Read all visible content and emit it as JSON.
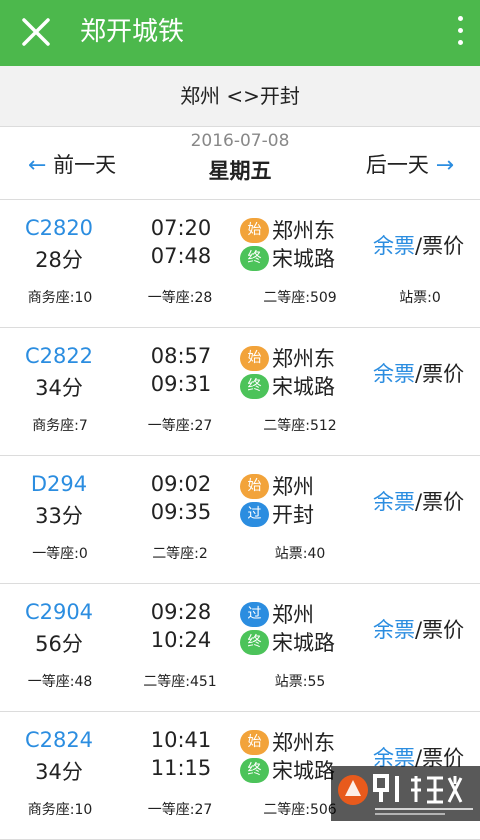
{
  "header": {
    "title": "郑开城铁"
  },
  "route": "郑州 <>开封",
  "date_bar": {
    "prev": "前一天",
    "next": "后一天",
    "date": "2016-07-08",
    "weekday": "星期五"
  },
  "badges": {
    "start": "始",
    "end": "终",
    "pass": "过"
  },
  "ticket_link": {
    "remaining": "余票",
    "price": "/票价"
  },
  "trains": [
    {
      "code": "C2820",
      "duration": "28分",
      "depart": "07:20",
      "arrive": "07:48",
      "from_type": "start",
      "from": "郑州东",
      "to_type": "end",
      "to": "宋城路",
      "seats": [
        "商务座:10",
        "一等座:28",
        "二等座:509",
        "站票:0"
      ]
    },
    {
      "code": "C2822",
      "duration": "34分",
      "depart": "08:57",
      "arrive": "09:31",
      "from_type": "start",
      "from": "郑州东",
      "to_type": "end",
      "to": "宋城路",
      "seats": [
        "商务座:7",
        "一等座:27",
        "二等座:512",
        ""
      ]
    },
    {
      "code": "D294",
      "duration": "33分",
      "depart": "09:02",
      "arrive": "09:35",
      "from_type": "start",
      "from": "郑州",
      "to_type": "pass",
      "to": "开封",
      "seats": [
        "一等座:0",
        "二等座:2",
        "站票:40",
        ""
      ]
    },
    {
      "code": "C2904",
      "duration": "56分",
      "depart": "09:28",
      "arrive": "10:24",
      "from_type": "pass",
      "from": "郑州",
      "to_type": "end",
      "to": "宋城路",
      "seats": [
        "一等座:48",
        "二等座:451",
        "站票:55",
        ""
      ]
    },
    {
      "code": "C2824",
      "duration": "34分",
      "depart": "10:41",
      "arrive": "11:15",
      "from_type": "start",
      "from": "郑州东",
      "to_type": "end",
      "to": "宋城路",
      "seats": [
        "商务座:10",
        "一等座:27",
        "二等座:506",
        ""
      ]
    }
  ],
  "watermark": {
    "logo": "9L游戏",
    "site": "91danji.com"
  },
  "colors": {
    "header_bg": "#4cb84c",
    "link_blue": "#2b8de0",
    "start": "#f2a33a",
    "end": "#4cc35a",
    "pass": "#2b8de0"
  },
  "icons": {
    "close": "close-icon",
    "more": "more-vertical-icon",
    "prev": "arrow-left-icon",
    "next": "arrow-right-icon"
  }
}
